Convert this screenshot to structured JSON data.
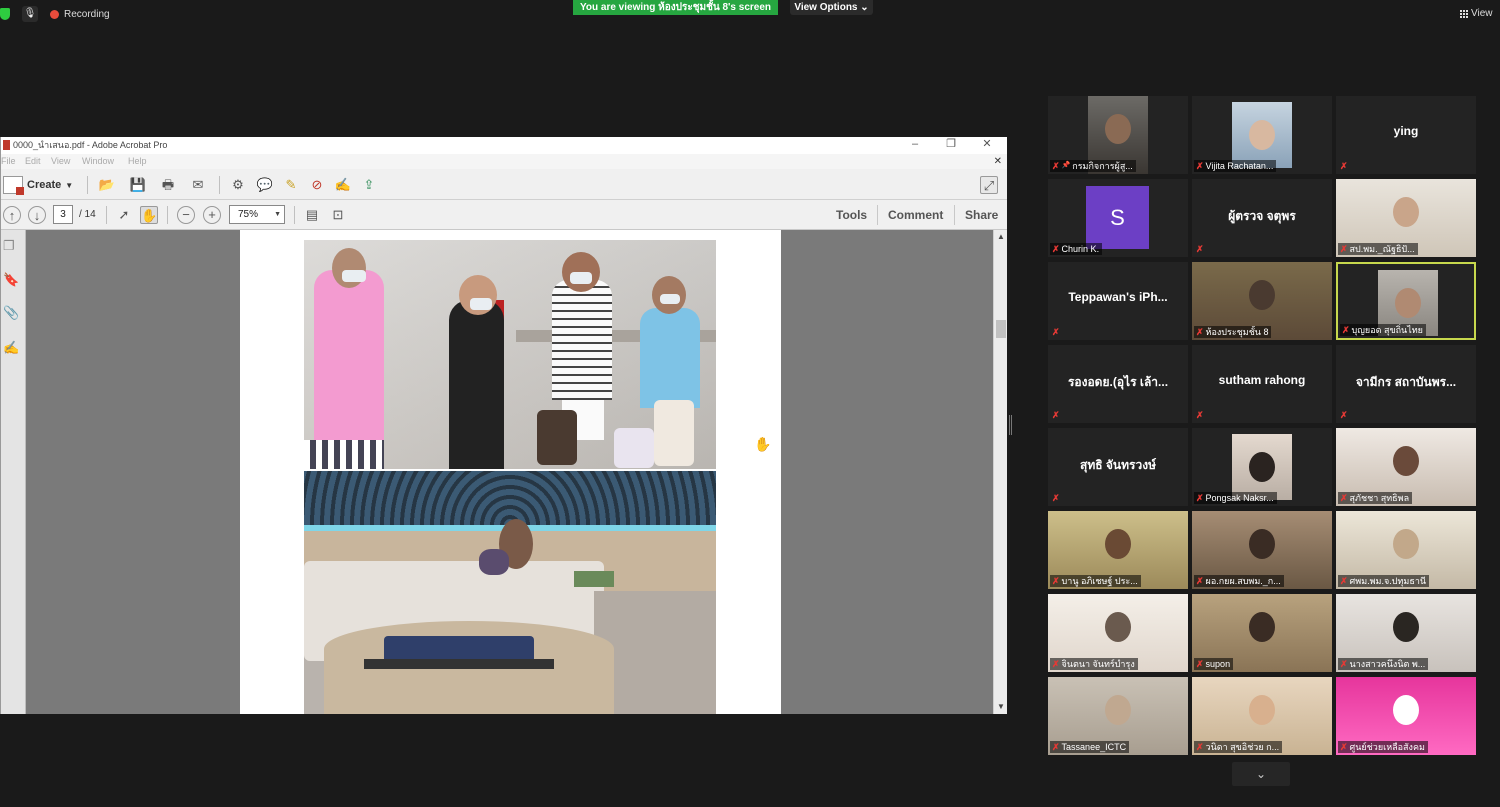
{
  "topbar": {
    "recording_label": "Recording",
    "viewing_banner": "You are viewing ห้องประชุมชั้น 8's screen",
    "view_options_label": "View Options ⌄",
    "view_label": "View"
  },
  "acrobat": {
    "title": "0000_นำเสนอ.pdf - Adobe Acrobat Pro",
    "menu": [
      "File",
      "Edit",
      "View",
      "Window",
      "Help"
    ],
    "create_label": "Create",
    "page_current": "3",
    "page_total": "/ 14",
    "zoom": "75%",
    "tools_label": "Tools",
    "comment_label": "Comment",
    "share_label": "Share"
  },
  "participants": [
    {
      "name": "กรมกิจการผู้สู...",
      "big": "",
      "muted": true,
      "pinned": true,
      "type": "video"
    },
    {
      "name": "Vijita Rachatan...",
      "big": "",
      "muted": true,
      "type": "video"
    },
    {
      "name": "",
      "big": "ying",
      "muted": true,
      "type": "name"
    },
    {
      "name": "Churin K.",
      "big": "",
      "avatar": "S",
      "muted": true,
      "type": "avatar"
    },
    {
      "name": "",
      "big": "ผู้ตรวจ จตุพร",
      "muted": true,
      "type": "name"
    },
    {
      "name": "สป.พม._ณัฐธิปั...",
      "big": "",
      "muted": true,
      "type": "video"
    },
    {
      "name": "",
      "big": "Teppawan's iPh...",
      "muted": true,
      "type": "name"
    },
    {
      "name": "ห้องประชุมชั้น 8",
      "big": "",
      "muted": true,
      "type": "video"
    },
    {
      "name": "บุญยอด สุขถิ่นไทย",
      "big": "",
      "muted": true,
      "type": "video",
      "active": true
    },
    {
      "name": "",
      "big": "รองอดย.(อุไร เล้า...",
      "muted": true,
      "type": "name"
    },
    {
      "name": "",
      "big": "sutham rahong",
      "muted": true,
      "type": "name"
    },
    {
      "name": "",
      "big": "จามีกร สถาบันพร...",
      "muted": true,
      "type": "name"
    },
    {
      "name": "",
      "big": "สุทธิ จันทรวงษ์",
      "muted": true,
      "type": "name"
    },
    {
      "name": "Pongsak Naksr...",
      "big": "",
      "muted": true,
      "type": "video"
    },
    {
      "name": "สุภัชชา สุทธิพล",
      "big": "",
      "muted": true,
      "type": "video"
    },
    {
      "name": "บานู อภิเชษฐ์ ประ...",
      "big": "",
      "muted": true,
      "type": "video"
    },
    {
      "name": "ผอ.กยผ.สบพม._ก...",
      "big": "",
      "muted": true,
      "type": "video"
    },
    {
      "name": "ศพม.พม.จ.ปทุมธานี",
      "big": "",
      "muted": true,
      "type": "video"
    },
    {
      "name": "จินตนา จันทร์บำรุง",
      "big": "",
      "muted": true,
      "type": "video"
    },
    {
      "name": "supon",
      "big": "",
      "muted": true,
      "type": "video"
    },
    {
      "name": "นางสาวคนึงนิต พ...",
      "big": "",
      "muted": true,
      "type": "video"
    },
    {
      "name": "Tassanee_ICTC",
      "big": "",
      "muted": true,
      "type": "video"
    },
    {
      "name": "วนิดา สุขอิช่วย ก...",
      "big": "",
      "muted": true,
      "type": "video"
    },
    {
      "name": "ศูนย์ช่วยเหลือสังคม",
      "big": "",
      "muted": true,
      "type": "video"
    }
  ],
  "colors": {
    "banner_green": "#26a640",
    "active_speaker": "#c7d84d",
    "mute_red": "#e53935",
    "avatar_purple": "#6c3fc5"
  }
}
